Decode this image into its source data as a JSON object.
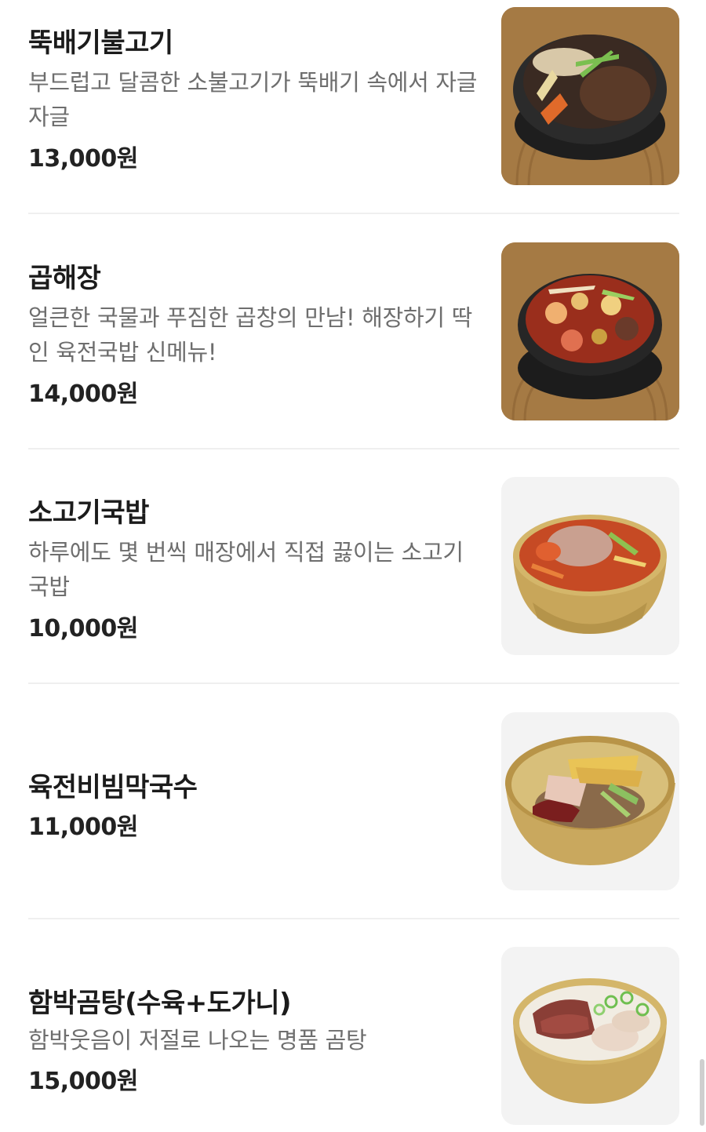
{
  "menu": {
    "items": [
      {
        "name": "뚝배기불고기",
        "description": "부드럽고 달콤한 소불고기가 뚝배기 속에서 자글자글",
        "price": "13,000원",
        "image": "ttukbaegi-bulgogi-photo"
      },
      {
        "name": "곱해장",
        "description": "얼큰한 국물과 푸짐한 곱창의 만남! 해장하기 딱인 육전국밥 신메뉴!",
        "price": "14,000원",
        "image": "gop-haejang-photo"
      },
      {
        "name": "소고기국밥",
        "description": "하루에도 몇 번씩 매장에서 직접 끓이는 소고기국밥",
        "price": "10,000원",
        "image": "sogogi-gukbap-photo"
      },
      {
        "name": "육전비빔막국수",
        "description": "",
        "price": "11,000원",
        "image": "yukjeon-bibim-makguksu-photo"
      },
      {
        "name": "함박곰탕(수육+도가니)",
        "description": "함박웃음이 저절로 나오는 명품 곰탕",
        "price": "15,000원",
        "image": "hambak-gomtang-photo"
      }
    ]
  },
  "colors": {
    "brown_bg": "#a57a44",
    "gray_bg": "#f3f3f3",
    "name_text": "#1b1b1b",
    "desc_text": "#6e6e6e",
    "divider": "#efefef"
  }
}
